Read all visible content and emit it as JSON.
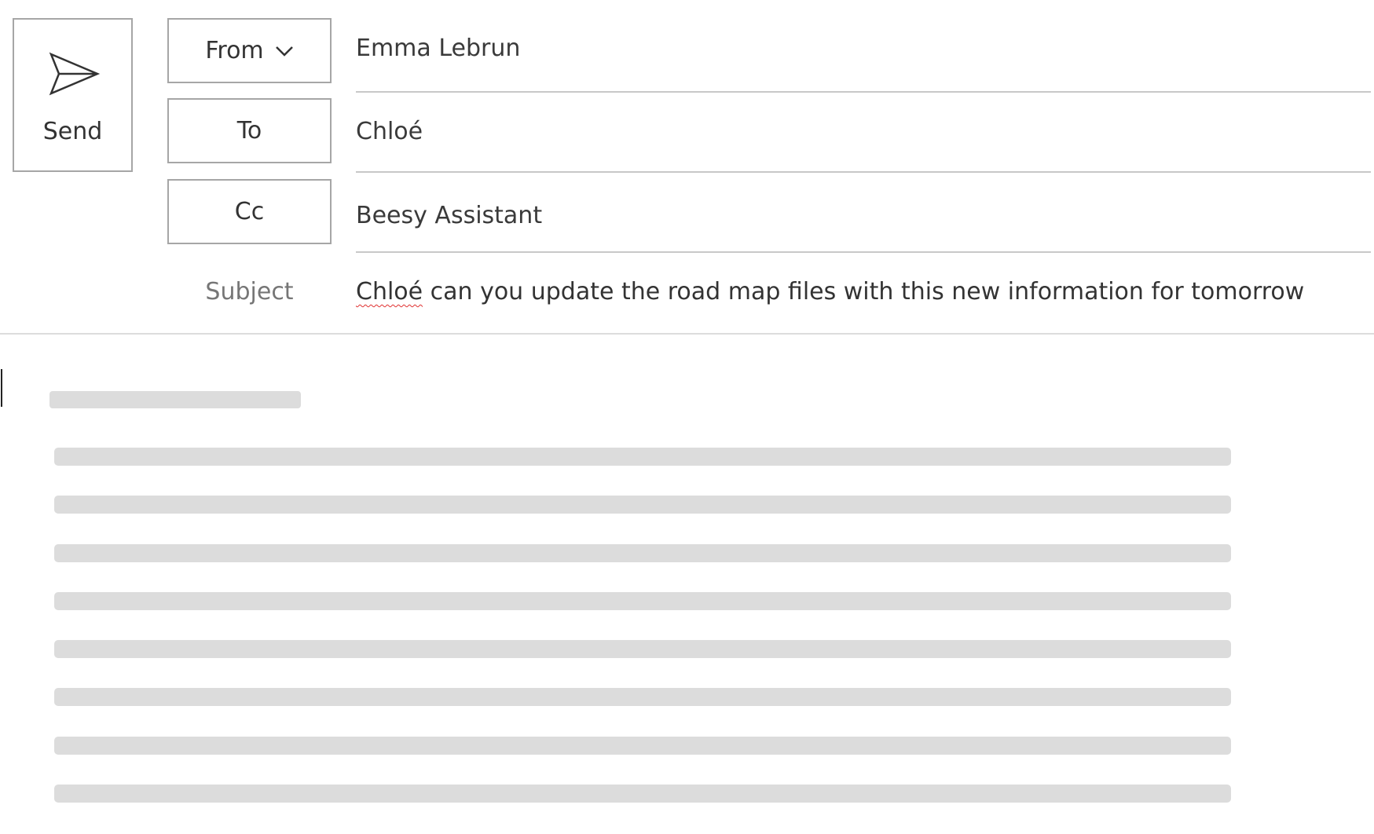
{
  "toolbar": {
    "send_label": "Send",
    "send_icon": "send-icon"
  },
  "fields": {
    "from": {
      "label": "From",
      "icon": "chevron-down-icon",
      "value": "Emma Lebrun"
    },
    "to": {
      "label": "To",
      "value": "Chloé"
    },
    "cc": {
      "label": "Cc",
      "value": "Beesy Assistant"
    },
    "subject": {
      "label": "Subject",
      "misspelled_word": "Chloé",
      "rest": " can you update the road map files with this new information for tomorrow"
    }
  },
  "body": {
    "state": "loading",
    "placeholder_lines": 8
  },
  "colors": {
    "border": "#a6a6a6",
    "text": "#333333",
    "muted_label": "#767676",
    "skeleton": "#dcdcdc",
    "spellcheck": "#e03030"
  }
}
